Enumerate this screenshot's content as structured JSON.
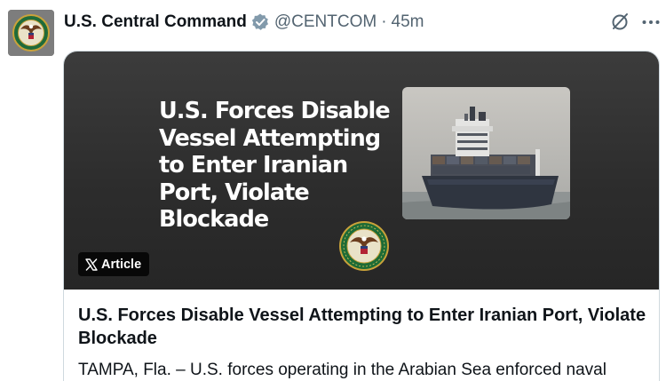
{
  "tweet": {
    "author": {
      "display_name": "U.S. Central Command",
      "handle": "@CENTCOM",
      "separator": "·",
      "time": "45m",
      "avatar_icon": "centcom-seal-icon",
      "verified_icon": "government-verified-badge-icon",
      "verified_color": "#829aab"
    },
    "actions": {
      "grok_icon": "grok-icon",
      "more_icon": "more-horizontal-icon"
    },
    "card": {
      "media": {
        "headline": "U.S. Forces Disable Vessel Attempting to Enter Iranian Port, Violate Blockade",
        "photo_icon": "container-ship-photo",
        "seal_icon": "centcom-seal-icon",
        "badge_label": "Article",
        "badge_icon": "x-logo-icon",
        "background_color": "#333333"
      },
      "title": "U.S. Forces Disable Vessel Attempting to Enter Iranian Port, Violate Blockade",
      "description": "TAMPA, Fla. – U.S. forces operating in the Arabian Sea enforced naval"
    }
  }
}
